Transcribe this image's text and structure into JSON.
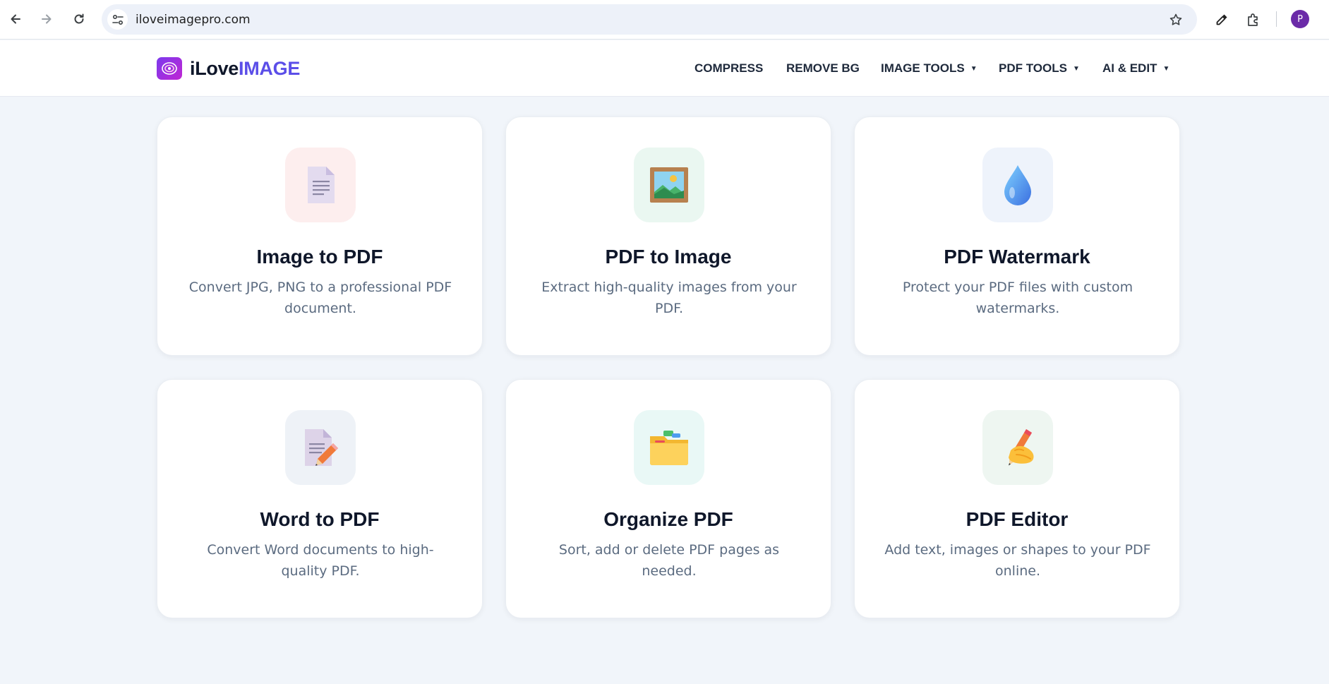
{
  "browser": {
    "url": "iloveimagepro.com",
    "profile_initial": "P",
    "icons": [
      "back-icon",
      "forward-icon",
      "reload-icon",
      "site-info-icon",
      "star-icon",
      "eyedropper-icon",
      "extensions-icon"
    ]
  },
  "header": {
    "logo_part1": "iLove",
    "logo_part2": "IMAGE",
    "nav": [
      {
        "label": "COMPRESS",
        "dropdown": false
      },
      {
        "label": "REMOVE BG",
        "dropdown": false
      },
      {
        "label": "IMAGE TOOLS",
        "dropdown": true
      },
      {
        "label": "PDF TOOLS",
        "dropdown": true
      },
      {
        "label": "AI & EDIT",
        "dropdown": true
      }
    ],
    "caret": "▼"
  },
  "tools": [
    {
      "title": "Image to PDF",
      "description": "Convert JPG, PNG to a professional PDF document.",
      "icon": "document-icon",
      "tint": "#fdeeee"
    },
    {
      "title": "PDF to Image",
      "description": "Extract high-quality images from your PDF.",
      "icon": "framed-picture-icon",
      "tint": "#eaf7f1"
    },
    {
      "title": "PDF Watermark",
      "description": "Protect your PDF files with custom watermarks.",
      "icon": "droplet-icon",
      "tint": "#eef3fb"
    },
    {
      "title": "Word to PDF",
      "description": "Convert Word documents to high-quality PDF.",
      "icon": "memo-pencil-icon",
      "tint": "#eef2f7"
    },
    {
      "title": "Organize PDF",
      "description": "Sort, add or delete PDF pages as needed.",
      "icon": "folder-icon",
      "tint": "#e9f8f6"
    },
    {
      "title": "PDF Editor",
      "description": "Add text, images or shapes to your PDF online.",
      "icon": "writing-hand-icon",
      "tint": "#eef6f1"
    }
  ]
}
